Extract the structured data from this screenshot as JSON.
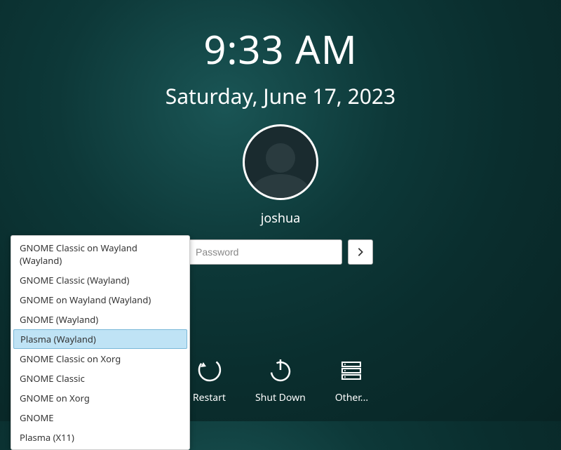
{
  "clock": {
    "time": "9:33 AM",
    "date": "Saturday, June 17, 2023"
  },
  "user": {
    "name": "joshua"
  },
  "password": {
    "placeholder": "Password"
  },
  "actions": {
    "restart": "Restart",
    "shutdown": "Shut Down",
    "other": "Other..."
  },
  "sessions": {
    "items": [
      "GNOME Classic on Wayland (Wayland)",
      "GNOME Classic (Wayland)",
      "GNOME on Wayland (Wayland)",
      "GNOME (Wayland)",
      "Plasma (Wayland)",
      "GNOME Classic on Xorg",
      "GNOME Classic",
      "GNOME on Xorg",
      "GNOME",
      "Plasma (X11)"
    ],
    "selected_index": 4
  }
}
